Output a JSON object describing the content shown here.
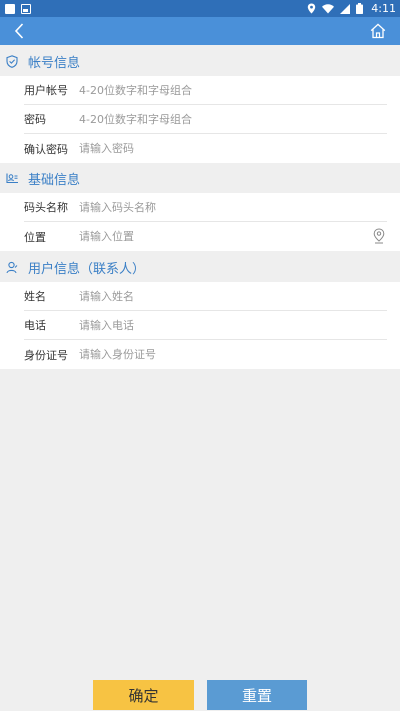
{
  "status_bar": {
    "time": "4:11",
    "bg_color": "#2f6fb8"
  },
  "app_bar": {
    "bg_color": "#4a90d9",
    "back_icon": "chevron-left-icon",
    "home_icon": "home-icon"
  },
  "sections": {
    "account": {
      "title": "帐号信息",
      "icon": "shield-check-icon",
      "fields": {
        "username": {
          "label": "用户帐号",
          "placeholder": "4-20位数字和字母组合"
        },
        "password": {
          "label": "密码",
          "placeholder": "4-20位数字和字母组合"
        },
        "confirm_password": {
          "label": "确认密码",
          "placeholder": "请输入密码"
        }
      }
    },
    "basic": {
      "title": "基础信息",
      "icon": "id-card-icon",
      "fields": {
        "dock_name": {
          "label": "码头名称",
          "placeholder": "请输入码头名称"
        },
        "location": {
          "label": "位置",
          "placeholder": "请输入位置",
          "icon": "location-pin-icon"
        }
      }
    },
    "user": {
      "title": "用户信息（联系人）",
      "icon": "user-icon",
      "fields": {
        "name": {
          "label": "姓名",
          "placeholder": "请输入姓名"
        },
        "phone": {
          "label": "电话",
          "placeholder": "请输入电话"
        },
        "id_number": {
          "label": "身份证号",
          "placeholder": "请输入身份证号"
        }
      }
    }
  },
  "actions": {
    "confirm_label": "确定",
    "reset_label": "重置",
    "confirm_color": "#f7c343",
    "reset_color": "#5a9bd3"
  },
  "accent_color": "#3a7fc6"
}
